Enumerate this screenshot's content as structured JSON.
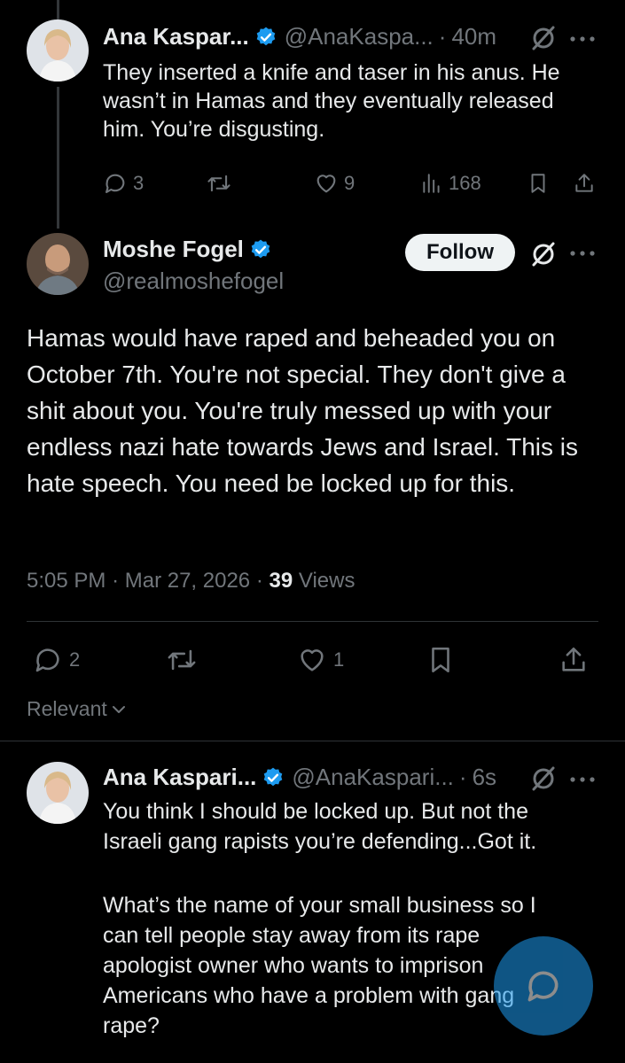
{
  "tweet1": {
    "name": "Ana Kaspar...",
    "handle": "@AnaKaspa...",
    "time": "40m",
    "text": "They inserted a knife and taser in his anus. He wasn’t in Hamas and they eventually released him. You’re disgusting.",
    "replies": "3",
    "likes": "9",
    "views": "168"
  },
  "main": {
    "name": "Moshe Fogel",
    "handle": "@realmoshefogel",
    "follow_label": "Follow",
    "text": "Hamas would have raped and beheaded you on October 7th. You're not special. They don't give a shit about you. You're truly messed up with your endless nazi hate towards Jews and Israel. This is hate speech. You need be locked up for this.",
    "time": "5:05 PM",
    "date": "Mar 27, 2026",
    "views_count": "39",
    "views_label": "Views",
    "replies": "2",
    "likes": "1"
  },
  "sort": {
    "label": "Relevant"
  },
  "reply": {
    "name": "Ana Kaspari...",
    "handle": "@AnaKaspari...",
    "time": "6s",
    "para1": "You think I should be locked up. But not the Israeli gang rapists you’re defending...Got it.",
    "para2": "What’s the name of your small business so I can tell people stay away from its rape apologist owner who wants to imprison Americans who have a problem with gang rape?"
  },
  "colors": {
    "accent": "#1d9bf0",
    "muted": "#71767b",
    "text": "#e7e9ea",
    "background": "#000000"
  },
  "icons": [
    "verified-badge-icon",
    "grok-icon",
    "more-icon",
    "reply-icon",
    "retweet-icon",
    "like-icon",
    "views-icon",
    "bookmark-icon",
    "share-icon",
    "chevron-down-icon",
    "compose-icon"
  ]
}
